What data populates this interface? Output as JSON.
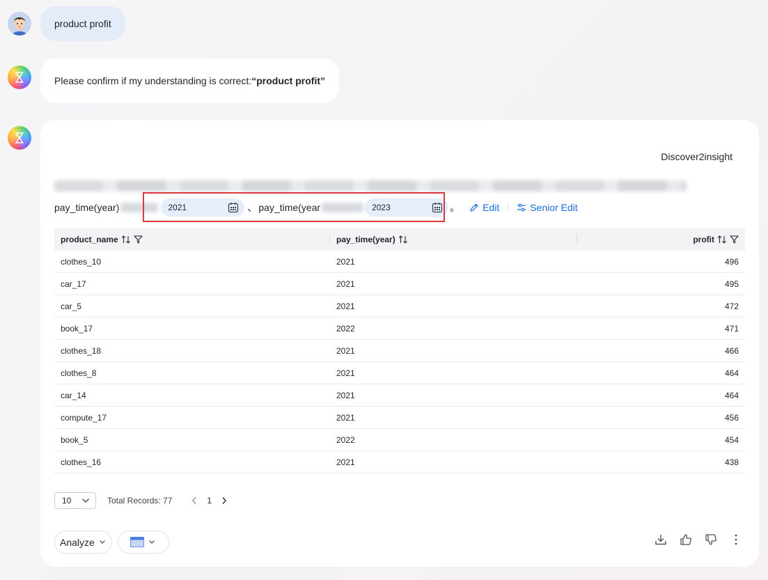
{
  "user_message": {
    "text": "product profit"
  },
  "bot_confirm": {
    "prefix": "Please confirm if my understanding is correct:",
    "query": "“product profit”"
  },
  "result_card": {
    "brand": "Discover2insight",
    "conditions": {
      "field1": "pay_time(year)",
      "date1": "2021",
      "separator": "、",
      "field2": "pay_time(year",
      "date2": "2023",
      "end_mark": "。",
      "edit_label": "Edit",
      "senior_edit_label": "Senior Edit"
    },
    "table": {
      "columns": [
        "product_name",
        "pay_time(year)",
        "profit"
      ],
      "rows": [
        [
          "clothes_10",
          "2021",
          "496"
        ],
        [
          "car_17",
          "2021",
          "495"
        ],
        [
          "car_5",
          "2021",
          "472"
        ],
        [
          "book_17",
          "2022",
          "471"
        ],
        [
          "clothes_18",
          "2021",
          "466"
        ],
        [
          "clothes_8",
          "2021",
          "464"
        ],
        [
          "car_14",
          "2021",
          "464"
        ],
        [
          "compute_17",
          "2021",
          "456"
        ],
        [
          "book_5",
          "2022",
          "454"
        ],
        [
          "clothes_16",
          "2021",
          "438"
        ]
      ]
    },
    "pagination": {
      "page_size": "10",
      "total_label": "Total Records: 77",
      "current_page": "1"
    },
    "actions": {
      "analyze_label": "Analyze"
    }
  },
  "colors": {
    "accent": "#1a6dde",
    "highlight_box": "#d9363e",
    "date_pill": "#e6eefb"
  }
}
